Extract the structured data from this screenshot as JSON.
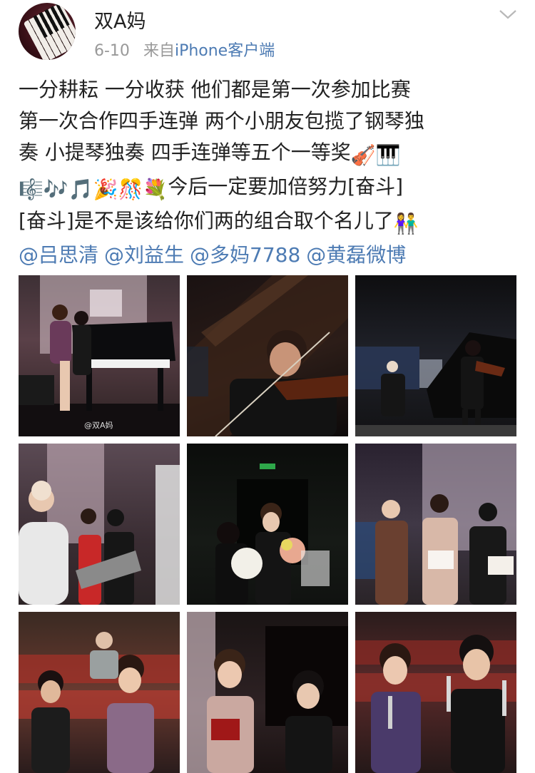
{
  "post": {
    "username": "双A妈",
    "date": "6-10",
    "source_prefix": "来自",
    "source": "iPhone客户端",
    "text_lines": [
      "一分耕耘 一分收获 他们都是第一次参加比赛",
      "第一次合作四手连弹 两个小朋友包揽了钢琴独",
      "奏 小提琴独奏 四手连弹等五个一等奖",
      "今后一定要加倍努力[奋斗]",
      "[奋斗]是不是该给你们两的组合取个名儿了"
    ],
    "emojis": {
      "line3": [
        "🎻",
        "🎹"
      ],
      "line4": [
        "🎼",
        "🎶",
        "🎵",
        "🎉",
        "🎊",
        "💐"
      ],
      "line5": [
        "👫"
      ]
    },
    "mentions": [
      "@吕思清",
      "@刘益生",
      "@多妈7788",
      "@黄磊微博"
    ]
  },
  "photos": [
    {
      "name": "photo-piano-duet",
      "watermark": "@双A妈"
    },
    {
      "name": "photo-violin-closeup"
    },
    {
      "name": "photo-violin-with-piano"
    },
    {
      "name": "photo-award-presentation"
    },
    {
      "name": "photo-flowers-backstage"
    },
    {
      "name": "photo-certificates-stage"
    },
    {
      "name": "photo-audience-seated"
    },
    {
      "name": "photo-stage-certificates"
    },
    {
      "name": "photo-holding-trophies"
    }
  ],
  "icons": {
    "avatar": "piano-keys-avatar",
    "menu": "chevron-down-icon"
  },
  "colors": {
    "link": "#4d7bb3",
    "meta": "#999999",
    "text": "#222222"
  }
}
